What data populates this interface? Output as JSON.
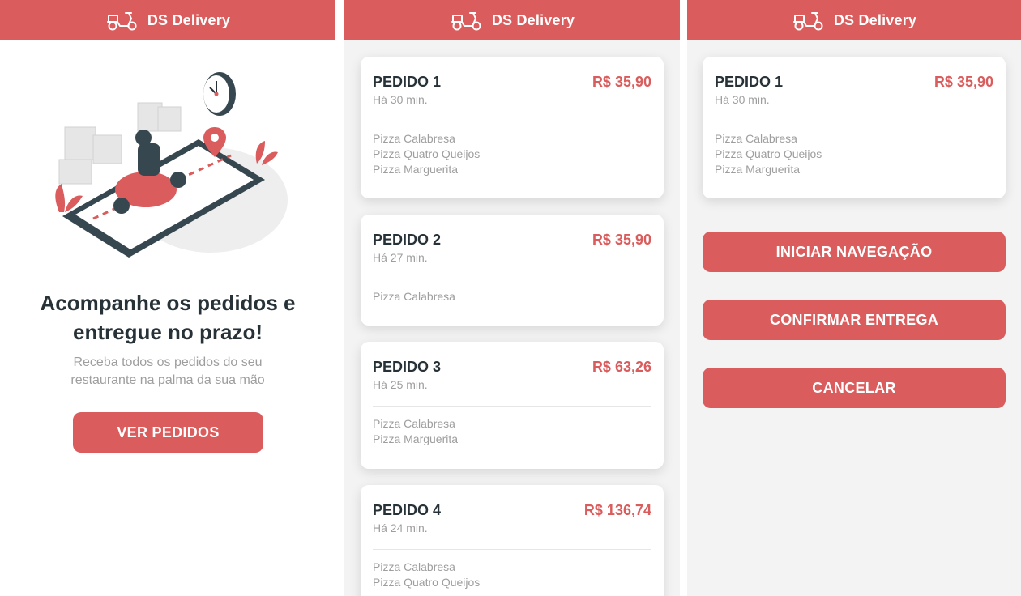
{
  "app": {
    "title": "DS Delivery",
    "logo_icon": "scooter-icon",
    "accent": "#da5c5c"
  },
  "home": {
    "heading_line1": "Acompanhe os pedidos e",
    "heading_line2": "entregue no prazo!",
    "subtitle": "Receba todos os pedidos do seu restaurante na palma da sua mão",
    "button": "VER PEDIDOS"
  },
  "orders": [
    {
      "name": "PEDIDO 1",
      "price": "R$ 35,90",
      "time": "Há 30 min.",
      "items": [
        "Pizza Calabresa",
        "Pizza Quatro Queijos",
        "Pizza Marguerita"
      ]
    },
    {
      "name": "PEDIDO 2",
      "price": "R$ 35,90",
      "time": "Há 27 min.",
      "items": [
        "Pizza Calabresa"
      ]
    },
    {
      "name": "PEDIDO 3",
      "price": "R$ 63,26",
      "time": "Há 25 min.",
      "items": [
        "Pizza Calabresa",
        "Pizza Marguerita"
      ]
    },
    {
      "name": "PEDIDO 4",
      "price": "R$ 136,74",
      "time": "Há 24 min.",
      "items": [
        "Pizza Calabresa",
        "Pizza Quatro Queijos"
      ]
    }
  ],
  "details": {
    "order": {
      "name": "PEDIDO 1",
      "price": "R$ 35,90",
      "time": "Há 30 min.",
      "items": [
        "Pizza Calabresa",
        "Pizza Quatro Queijos",
        "Pizza Marguerita"
      ]
    },
    "start_nav": "INICIAR NAVEGAÇÃO",
    "confirm": "CONFIRMAR ENTREGA",
    "cancel": "CANCELAR"
  }
}
